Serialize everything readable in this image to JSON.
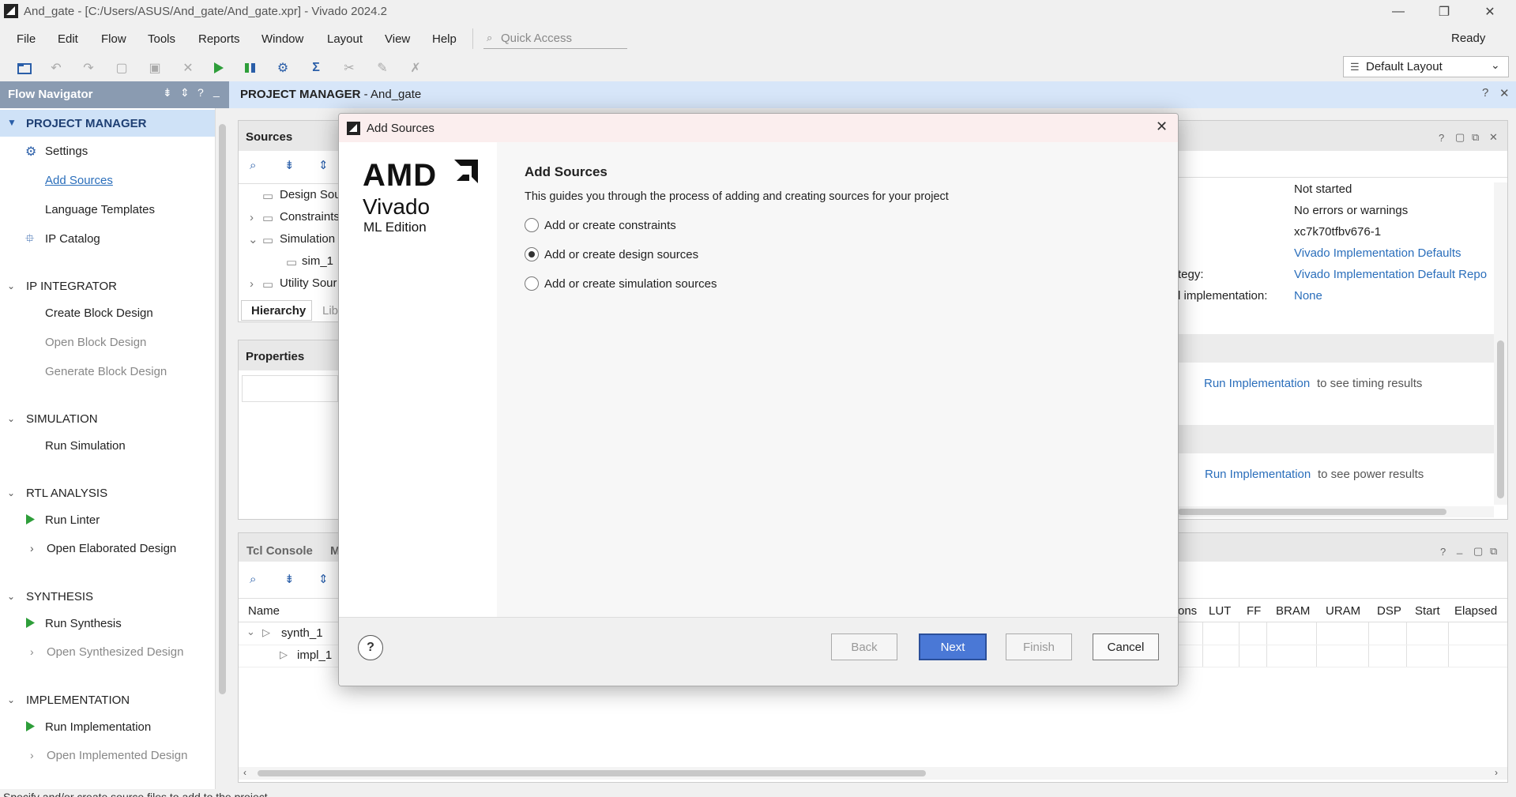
{
  "window": {
    "title": "And_gate - [C:/Users/ASUS/And_gate/And_gate.xpr] - Vivado 2024.2"
  },
  "menu": {
    "file": "File",
    "edit": "Edit",
    "flow": "Flow",
    "tools": "Tools",
    "reports": "Reports",
    "window": "Window",
    "layout": "Layout",
    "view": "View",
    "help": "Help"
  },
  "quick_access": {
    "placeholder": "Quick Access"
  },
  "status": {
    "ready": "Ready"
  },
  "layout_selector": {
    "value": "Default Layout"
  },
  "flow_navigator": {
    "title": "Flow Navigator",
    "project_manager": {
      "label": "PROJECT MANAGER",
      "settings": "Settings",
      "add_sources": "Add Sources",
      "language_templates": "Language Templates",
      "ip_catalog": "IP Catalog"
    },
    "ip_integrator": {
      "label": "IP INTEGRATOR",
      "create_block": "Create Block Design",
      "open_block": "Open Block Design",
      "generate_block": "Generate Block Design"
    },
    "simulation": {
      "label": "SIMULATION",
      "run": "Run Simulation"
    },
    "rtl_analysis": {
      "label": "RTL ANALYSIS",
      "run_linter": "Run Linter",
      "open_elaborated": "Open Elaborated Design"
    },
    "synthesis": {
      "label": "SYNTHESIS",
      "run": "Run Synthesis",
      "open": "Open Synthesized Design"
    },
    "implementation": {
      "label": "IMPLEMENTATION",
      "run": "Run Implementation",
      "open": "Open Implemented Design"
    }
  },
  "project_manager_header": {
    "title": "PROJECT MANAGER",
    "project": " - And_gate"
  },
  "sources": {
    "title": "Sources",
    "tree": {
      "design": "Design Sou",
      "constraints": "Constraints",
      "simulation": "Simulation",
      "sim1": "sim_1",
      "utility": "Utility Sour"
    },
    "tabs": {
      "hierarchy": "Hierarchy",
      "libraries": "Lib"
    }
  },
  "properties": {
    "title": "Properties"
  },
  "summary": {
    "status": "Not started",
    "messages": "No errors or warnings",
    "part": "xc7k70tfbv676-1",
    "strategy_label": "tegy:",
    "strategy": "Vivado Implementation Defaults",
    "report_strategy": "Vivado Implementation Default Repo",
    "incremental_label": "l implementation:",
    "incremental": "None",
    "timing_link": "Run Implementation",
    "timing_text": "to see timing results",
    "power_link": "Run Implementation",
    "power_text": "to see power results"
  },
  "tcl": {
    "tab": "Tcl Console",
    "tab2": "M"
  },
  "runs": {
    "columns": [
      "Name",
      "ons",
      "LUT",
      "FF",
      "BRAM",
      "URAM",
      "DSP",
      "Start",
      "Elapsed"
    ],
    "rows": [
      "synth_1",
      "impl_1"
    ]
  },
  "dialog": {
    "title": "Add Sources",
    "brand": {
      "amd": "AMD",
      "vivado": "Vivado",
      "edition": "ML Edition"
    },
    "heading": "Add Sources",
    "description": "This guides you through the process of adding and creating sources for your project",
    "options": [
      {
        "label": "Add or create constraints",
        "selected": false
      },
      {
        "label": "Add or create design sources",
        "selected": true
      },
      {
        "label": "Add or create simulation sources",
        "selected": false
      }
    ],
    "buttons": {
      "help": "?",
      "back": "Back",
      "next": "Next",
      "finish": "Finish",
      "cancel": "Cancel"
    }
  },
  "statusbar": {
    "text": "Specify and/or create source files to add to the project"
  }
}
